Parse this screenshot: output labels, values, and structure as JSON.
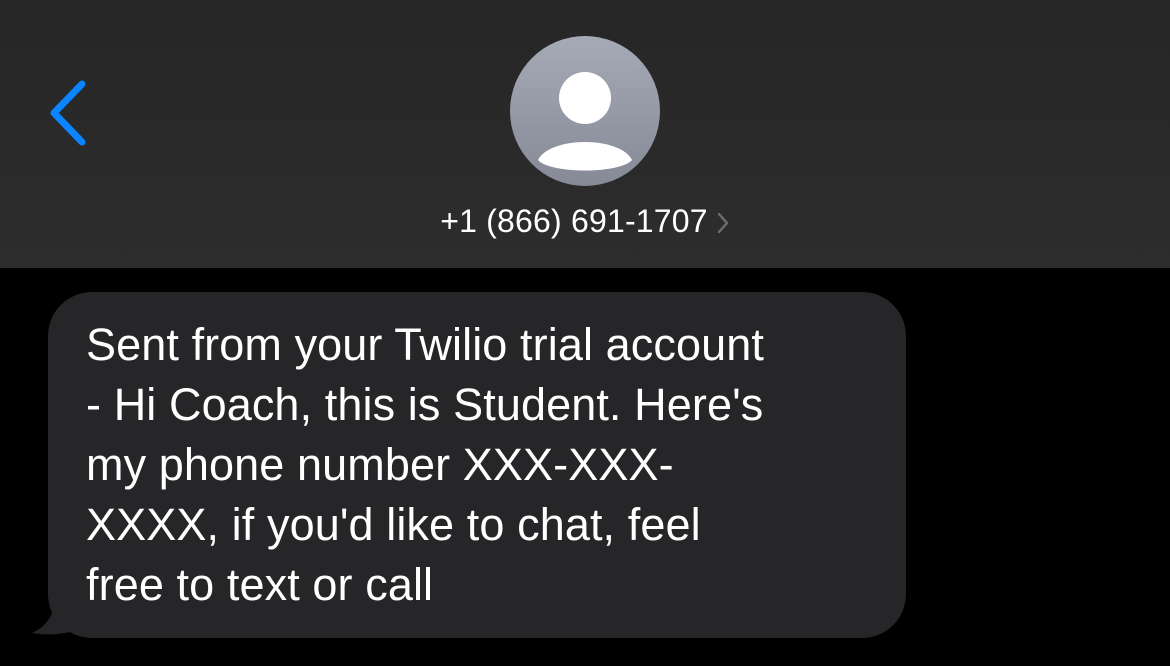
{
  "colors": {
    "accent": "#0a84ff",
    "header_background": "#2a2a2b",
    "bubble_background": "#262629",
    "screen_background": "#000000",
    "avatar_background": "#989ca8",
    "text": "#ffffff",
    "chevron": "#6e6e73"
  },
  "header": {
    "back_icon": "chevron-left-icon",
    "avatar_icon": "person-icon",
    "contact_name": "+1 (866) 691-1707",
    "contact_chevron_icon": "chevron-right-icon"
  },
  "thread": {
    "messages": [
      {
        "direction": "incoming",
        "text": "Sent from your Twilio trial account\n- Hi Coach, this is Student.  Here's\nmy phone number XXX-XXX-\nXXXX, if you'd like to chat, feel\nfree to text or call"
      }
    ]
  }
}
